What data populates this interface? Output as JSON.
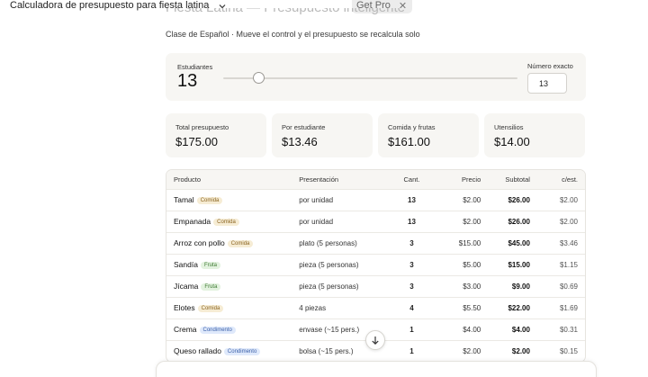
{
  "app": {
    "title": "Calculadora de presupuesto para fiesta latina",
    "get_pro": "Get Pro"
  },
  "page": {
    "heading": "Fiesta Latina — Presupuesto inteligente",
    "subtitle": "Clase de Español · Mueve el control y el presupuesto se recalcula solo"
  },
  "slider": {
    "label": "Estudiantes",
    "value": "13",
    "exact_label": "Número exacto",
    "input_value": "13",
    "level_fraction": 0.12
  },
  "stats": [
    {
      "title": "Total presupuesto",
      "value": "$175.00"
    },
    {
      "title": "Por estudiante",
      "value": "$13.46"
    },
    {
      "title": "Comida y frutas",
      "value": "$161.00"
    },
    {
      "title": "Utensilios",
      "value": "$14.00"
    }
  ],
  "table": {
    "headers": [
      "Producto",
      "Presentación",
      "Cant.",
      "Precio",
      "Subtotal",
      "c/est."
    ],
    "rows": [
      {
        "name": "Tamal",
        "tag": "Comida",
        "tag_type": "comida",
        "pres": "por unidad",
        "qty": "13",
        "price": "$2.00",
        "subtotal": "$26.00",
        "per": "$2.00"
      },
      {
        "name": "Empanada",
        "tag": "Comida",
        "tag_type": "comida",
        "pres": "por unidad",
        "qty": "13",
        "price": "$2.00",
        "subtotal": "$26.00",
        "per": "$2.00"
      },
      {
        "name": "Arroz con pollo",
        "tag": "Comida",
        "tag_type": "comida",
        "pres": "plato (5 personas)",
        "qty": "3",
        "price": "$15.00",
        "subtotal": "$45.00",
        "per": "$3.46"
      },
      {
        "name": "Sandía",
        "tag": "Fruta",
        "tag_type": "fruta",
        "pres": "pieza (5 personas)",
        "qty": "3",
        "price": "$5.00",
        "subtotal": "$15.00",
        "per": "$1.15"
      },
      {
        "name": "Jícama",
        "tag": "Fruta",
        "tag_type": "fruta",
        "pres": "pieza (5 personas)",
        "qty": "3",
        "price": "$3.00",
        "subtotal": "$9.00",
        "per": "$0.69"
      },
      {
        "name": "Elotes",
        "tag": "Comida",
        "tag_type": "comida",
        "pres": "4 piezas",
        "qty": "4",
        "price": "$5.50",
        "subtotal": "$22.00",
        "per": "$1.69"
      },
      {
        "name": "Crema",
        "tag": "Condimento",
        "tag_type": "condimento",
        "pres": "envase (~15 pers.)",
        "qty": "1",
        "price": "$4.00",
        "subtotal": "$4.00",
        "per": "$0.31"
      },
      {
        "name": "Queso rallado",
        "tag": "Condimento",
        "tag_type": "condimento",
        "pres": "bolsa (~15 pers.)",
        "qty": "1",
        "price": "$2.00",
        "subtotal": "$2.00",
        "per": "$0.15"
      }
    ]
  },
  "icons": {
    "dropdown": "chevron-down-icon",
    "close": "close-icon",
    "scroll": "arrow-down-icon"
  }
}
